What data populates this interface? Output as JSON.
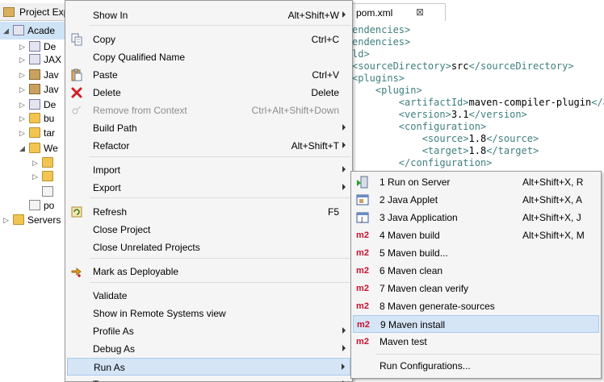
{
  "explorer": {
    "tab_label": "Project Exp",
    "rows": [
      {
        "label": "Acade",
        "kind": "project",
        "twist": "◢"
      },
      {
        "label": "De",
        "kind": "pkg",
        "twist": "▷"
      },
      {
        "label": "JAX",
        "kind": "pkg",
        "twist": "▷"
      },
      {
        "label": "Jav",
        "kind": "jav",
        "twist": "▷"
      },
      {
        "label": "Jav",
        "kind": "jav",
        "twist": "▷"
      },
      {
        "label": "De",
        "kind": "pkg",
        "twist": "▷"
      },
      {
        "label": "bu",
        "kind": "fld",
        "twist": "▷"
      },
      {
        "label": "tar",
        "kind": "fld",
        "twist": "▷"
      },
      {
        "label": "We",
        "kind": "fld",
        "twist": "◢"
      },
      {
        "label": "",
        "kind": "fld",
        "twist": "▷"
      },
      {
        "label": "",
        "kind": "fld",
        "twist": "▷"
      },
      {
        "label": "",
        "kind": "xmlf",
        "twist": ""
      },
      {
        "label": "po",
        "kind": "xmlf",
        "twist": ""
      },
      {
        "label": "Servers",
        "kind": "fld",
        "twist": "▷"
      }
    ]
  },
  "editor": {
    "tab_label": "pom.xml",
    "tab_close": "⊠",
    "lines": [
      {
        "tag": "endencies>",
        "txt": ""
      },
      {
        "tag": "endencies>",
        "txt": ""
      },
      {
        "tag": "ld>",
        "txt": ""
      },
      {
        "tag": "<sourceDirectory>",
        "txt": "src",
        "tag2": "</sourceDirectory>"
      },
      {
        "tag": "<plugins>",
        "txt": ""
      },
      {
        "tag": "    <plugin>",
        "txt": ""
      },
      {
        "tag": "        <artifactId>",
        "txt": "maven-compiler-plugin",
        "tag2": "</a"
      },
      {
        "tag": "        <version>",
        "txt": "3.1",
        "tag2": "</version>"
      },
      {
        "tag": "        <configuration>",
        "txt": ""
      },
      {
        "tag": "            <source>",
        "txt": "1.8",
        "tag2": "</source>"
      },
      {
        "tag": "            <target>",
        "txt": "1.8",
        "tag2": "</target>"
      },
      {
        "tag": "        </configuration>",
        "txt": ""
      }
    ]
  },
  "context_menu": {
    "items": [
      {
        "label": "Show In",
        "accel": "Alt+Shift+W",
        "submenu": true,
        "icon": ""
      },
      {
        "sep": true
      },
      {
        "label": "Copy",
        "accel": "Ctrl+C",
        "icon": "copy-icon"
      },
      {
        "label": "Copy Qualified Name",
        "accel": "",
        "icon": "copy-qualified-icon"
      },
      {
        "label": "Paste",
        "accel": "Ctrl+V",
        "icon": "paste-icon"
      },
      {
        "label": "Delete",
        "accel": "Delete",
        "icon": "delete-icon"
      },
      {
        "label": "Remove from Context",
        "accel": "Ctrl+Alt+Shift+Down",
        "disabled": true,
        "icon": "remove-context-icon"
      },
      {
        "label": "Build Path",
        "accel": "",
        "submenu": true,
        "icon": ""
      },
      {
        "label": "Refactor",
        "accel": "Alt+Shift+T",
        "submenu": true,
        "icon": ""
      },
      {
        "sep": true
      },
      {
        "label": "Import",
        "accel": "",
        "submenu": true,
        "icon": ""
      },
      {
        "label": "Export",
        "accel": "",
        "submenu": true,
        "icon": ""
      },
      {
        "sep": true
      },
      {
        "label": "Refresh",
        "accel": "F5",
        "icon": "refresh-icon"
      },
      {
        "label": "Close Project",
        "accel": "",
        "icon": ""
      },
      {
        "label": "Close Unrelated Projects",
        "accel": "",
        "icon": ""
      },
      {
        "sep": true
      },
      {
        "label": "Mark as Deployable",
        "accel": "",
        "icon": "deployable-icon"
      },
      {
        "sep": true
      },
      {
        "label": "Validate",
        "accel": "",
        "icon": ""
      },
      {
        "label": "Show in Remote Systems view",
        "accel": "",
        "icon": ""
      },
      {
        "label": "Profile As",
        "accel": "",
        "submenu": true,
        "icon": ""
      },
      {
        "label": "Debug As",
        "accel": "",
        "submenu": true,
        "icon": ""
      },
      {
        "label": "Run As",
        "accel": "",
        "submenu": true,
        "highlighted": true,
        "icon": ""
      },
      {
        "label": "T",
        "accel": "",
        "submenu": true,
        "icon": ""
      }
    ]
  },
  "run_as_menu": {
    "m2_glyph": "m2",
    "items": [
      {
        "label": "1 Run on Server",
        "accel": "Alt+Shift+X, R",
        "icon": "run-on-server-icon"
      },
      {
        "label": "2 Java Applet",
        "accel": "Alt+Shift+X, A",
        "icon": "java-applet-icon"
      },
      {
        "label": "3 Java Application",
        "accel": "Alt+Shift+X, J",
        "icon": "java-application-icon"
      },
      {
        "label": "4 Maven build",
        "accel": "Alt+Shift+X, M",
        "icon": "m2"
      },
      {
        "label": "5 Maven build...",
        "accel": "",
        "icon": "m2"
      },
      {
        "label": "6 Maven clean",
        "accel": "",
        "icon": "m2"
      },
      {
        "label": "7 Maven clean verify",
        "accel": "",
        "icon": "m2"
      },
      {
        "label": "8 Maven generate-sources",
        "accel": "",
        "icon": "m2"
      },
      {
        "label": "9 Maven install",
        "accel": "",
        "icon": "m2",
        "highlighted": true
      },
      {
        "label": "Maven test",
        "accel": "",
        "icon": "m2"
      },
      {
        "sep": true
      },
      {
        "label": "Run Configurations...",
        "accel": "",
        "icon": ""
      }
    ]
  }
}
